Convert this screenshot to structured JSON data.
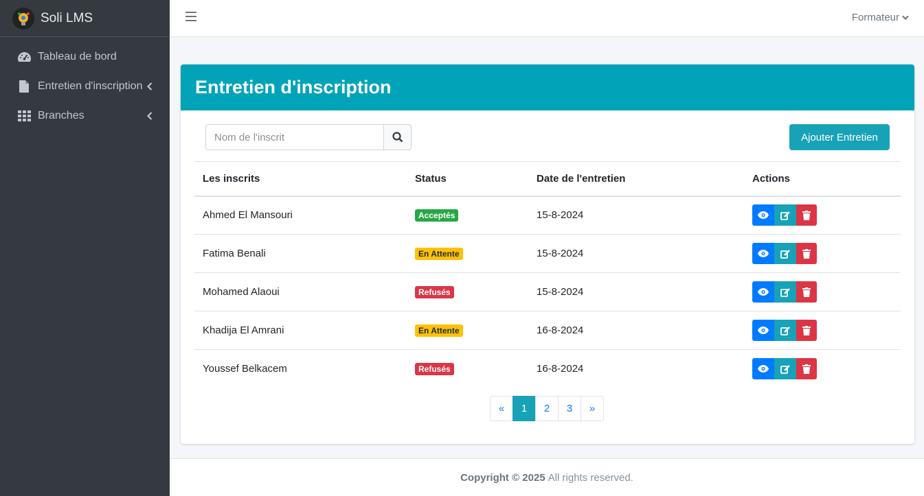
{
  "app": {
    "title": "Soli LMS"
  },
  "sidebar": {
    "items": [
      {
        "label": "Tableau de bord",
        "icon": "tachometer-icon"
      },
      {
        "label": "Entretien d'inscription",
        "icon": "file-icon"
      },
      {
        "label": "Branches",
        "icon": "grid-icon"
      }
    ]
  },
  "topbar": {
    "user_label": "Formateur"
  },
  "page": {
    "title": "Entretien d'inscription",
    "search_placeholder": "Nom de l'inscrit",
    "add_button": "Ajouter Entretien"
  },
  "table": {
    "columns": [
      "Les inscrits",
      "Status",
      "Date de l'entretien",
      "Actions"
    ],
    "rows": [
      {
        "name": "Ahmed El Mansouri",
        "status": "Acceptés",
        "status_color": "#28a745",
        "date": "15-8-2024"
      },
      {
        "name": "Fatima Benali",
        "status": "En Attente",
        "status_color": "#ffc107",
        "date": "15-8-2024"
      },
      {
        "name": "Mohamed Alaoui",
        "status": "Refusés",
        "status_color": "#dc3545",
        "date": "15-8-2024"
      },
      {
        "name": "Khadija El Amrani",
        "status": "En Attente",
        "status_color": "#ffc107",
        "date": "16-8-2024"
      },
      {
        "name": "Youssef Belkacem",
        "status": "Refusés",
        "status_color": "#dc3545",
        "date": "16-8-2024"
      }
    ]
  },
  "pagination": {
    "prev": "«",
    "pages": [
      "1",
      "2",
      "3"
    ],
    "next": "»",
    "active": "1"
  },
  "footer": {
    "copyright": "Copyright © 2025",
    "rights": "All rights reserved."
  }
}
